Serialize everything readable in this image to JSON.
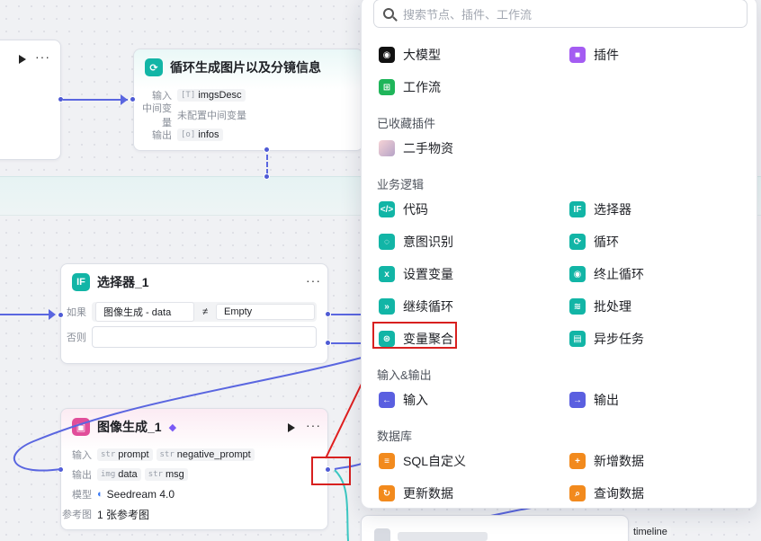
{
  "canvas": {
    "loop_node": {
      "title": "循环生成图片以及分镜信息",
      "rows": [
        {
          "key": "输入",
          "type": "[T]",
          "value": "imgsDesc"
        },
        {
          "key": "中间变量",
          "type": "",
          "value": "未配置中间变量"
        },
        {
          "key": "输出",
          "type": "[o]",
          "value": "infos"
        }
      ]
    },
    "selector_node": {
      "title": "选择器_1",
      "if_label": "如果",
      "else_label": "否则",
      "condition_left": "图像生成 - data",
      "operator": "≠",
      "condition_right": "Empty"
    },
    "image_node": {
      "title": "图像生成_1",
      "input_label": "输入",
      "inputs": [
        {
          "type": "str",
          "value": "prompt"
        },
        {
          "type": "str",
          "value": "negative_prompt"
        }
      ],
      "output_label": "输出",
      "outputs": [
        {
          "type": "img",
          "value": "data"
        },
        {
          "type": "str",
          "value": "msg"
        }
      ],
      "model_label": "模型",
      "model": "Seedream 4.0",
      "ref_label": "参考图",
      "ref_value": "1 张参考图"
    },
    "bottom_tag": "timeline"
  },
  "picker": {
    "search_placeholder": "搜索节点、插件、工作流",
    "top_items": [
      {
        "label": "大模型",
        "icon": "llm-icon"
      },
      {
        "label": "插件",
        "icon": "plugin-icon"
      },
      {
        "label": "工作流",
        "icon": "workflow-icon"
      }
    ],
    "favorites_title": "已收藏插件",
    "favorites": [
      {
        "label": "二手物资",
        "icon": "avatar-icon"
      }
    ],
    "logic_title": "业务逻辑",
    "logic_items": [
      {
        "label": "代码",
        "icon": "code-icon"
      },
      {
        "label": "选择器",
        "icon": "if-icon"
      },
      {
        "label": "意图识别",
        "icon": "intent-icon"
      },
      {
        "label": "循环",
        "icon": "loop-icon"
      },
      {
        "label": "设置变量",
        "icon": "set-variable-icon"
      },
      {
        "label": "终止循环",
        "icon": "stop-loop-icon"
      },
      {
        "label": "继续循环",
        "icon": "continue-loop-icon"
      },
      {
        "label": "批处理",
        "icon": "batch-icon"
      },
      {
        "label": "变量聚合",
        "icon": "variable-merge-icon"
      },
      {
        "label": "异步任务",
        "icon": "async-task-icon"
      }
    ],
    "io_title": "输入&输出",
    "io_items": [
      {
        "label": "输入",
        "icon": "input-icon"
      },
      {
        "label": "输出",
        "icon": "output-icon"
      }
    ],
    "db_title": "数据库",
    "db_items": [
      {
        "label": "SQL自定义",
        "icon": "sql-icon"
      },
      {
        "label": "新增数据",
        "icon": "insert-data-icon"
      },
      {
        "label": "更新数据",
        "icon": "update-data-icon"
      },
      {
        "label": "查询数据",
        "icon": "query-data-icon"
      }
    ]
  },
  "colors": {
    "accent": "#5a66e0",
    "teal": "#12b5a6",
    "highlight": "#d8201f"
  }
}
